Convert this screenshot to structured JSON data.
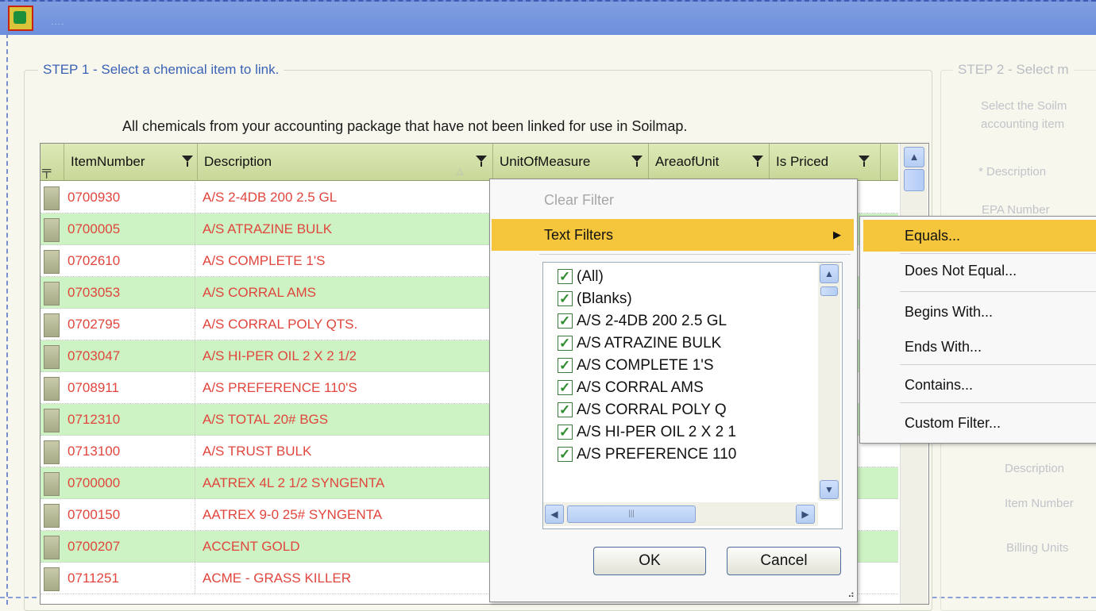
{
  "window": {
    "title_dots": "...."
  },
  "step1": {
    "title": "STEP 1 - Select a chemical item to link.",
    "intro": "All chemicals from your accounting package that have not been linked for use in Soilmap."
  },
  "step2": {
    "title": "STEP 2 - Select m",
    "instr1": "Select the Soilm",
    "instr2": "accounting item",
    "desc_label": "* Description",
    "epa_label": "EPA Number",
    "description": "Description",
    "item_number": "Item Number",
    "billing_units": "Billing Units"
  },
  "grid": {
    "columns": [
      "ItemNumber",
      "Description",
      "UnitOfMeasure",
      "AreaofUnit",
      "Is Priced"
    ],
    "rows": [
      {
        "item": "0700930",
        "desc": "A/S 2-4DB 200  2.5 GL"
      },
      {
        "item": "0700005",
        "desc": "A/S ATRAZINE BULK"
      },
      {
        "item": "0702610",
        "desc": "A/S COMPLETE 1'S"
      },
      {
        "item": "0703053",
        "desc": "A/S CORRAL AMS"
      },
      {
        "item": "0702795",
        "desc": "A/S CORRAL POLY  QTS."
      },
      {
        "item": "0703047",
        "desc": "A/S HI-PER OIL 2 X 2 1/2"
      },
      {
        "item": "0708911",
        "desc": "A/S PREFERENCE 110'S"
      },
      {
        "item": "0712310",
        "desc": "A/S TOTAL  20# BGS"
      },
      {
        "item": "0713100",
        "desc": "A/S TRUST BULK"
      },
      {
        "item": "0700000",
        "desc": "AATREX 4L 2 1/2 SYNGENTA"
      },
      {
        "item": "0700150",
        "desc": "AATREX 9-0  25# SYNGENTA"
      },
      {
        "item": "0700207",
        "desc": "ACCENT GOLD"
      },
      {
        "item": "0711251",
        "desc": "ACME - GRASS KILLER"
      }
    ]
  },
  "filter_popup": {
    "clear_filter": "Clear Filter",
    "text_filters": "Text Filters",
    "values": [
      "(All)",
      "(Blanks)",
      "A/S 2-4DB 200  2.5 GL",
      "A/S ATRAZINE BULK",
      "A/S COMPLETE 1'S",
      "A/S CORRAL AMS",
      "A/S CORRAL POLY  Q",
      "A/S HI-PER OIL 2 X 2 1",
      "A/S PREFERENCE 110"
    ],
    "ok": "OK",
    "cancel": "Cancel"
  },
  "submenu": {
    "items": [
      "Equals...",
      "Does Not Equal...",
      "Begins With...",
      "Ends With...",
      "Contains...",
      "Custom Filter..."
    ]
  },
  "colors": {
    "row_text": "#e0463d",
    "alt_row": "#cdf3c4",
    "highlight": "#f5c53c",
    "step_title": "#3a62b5"
  }
}
